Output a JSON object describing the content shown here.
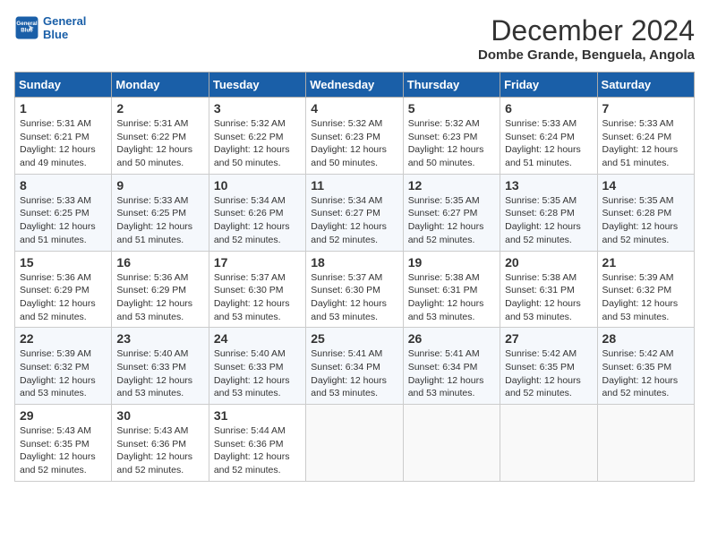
{
  "header": {
    "logo_line1": "General",
    "logo_line2": "Blue",
    "title": "December 2024",
    "subtitle": "Dombe Grande, Benguela, Angola"
  },
  "calendar": {
    "days_of_week": [
      "Sunday",
      "Monday",
      "Tuesday",
      "Wednesday",
      "Thursday",
      "Friday",
      "Saturday"
    ],
    "weeks": [
      [
        null,
        {
          "day": "2",
          "sunrise": "5:31 AM",
          "sunset": "6:22 PM",
          "daylight": "12 hours and 50 minutes."
        },
        {
          "day": "3",
          "sunrise": "5:32 AM",
          "sunset": "6:22 PM",
          "daylight": "12 hours and 50 minutes."
        },
        {
          "day": "4",
          "sunrise": "5:32 AM",
          "sunset": "6:23 PM",
          "daylight": "12 hours and 50 minutes."
        },
        {
          "day": "5",
          "sunrise": "5:32 AM",
          "sunset": "6:23 PM",
          "daylight": "12 hours and 50 minutes."
        },
        {
          "day": "6",
          "sunrise": "5:33 AM",
          "sunset": "6:24 PM",
          "daylight": "12 hours and 51 minutes."
        },
        {
          "day": "7",
          "sunrise": "5:33 AM",
          "sunset": "6:24 PM",
          "daylight": "12 hours and 51 minutes."
        }
      ],
      [
        {
          "day": "1",
          "sunrise": "5:31 AM",
          "sunset": "6:21 PM",
          "daylight": "12 hours and 49 minutes."
        },
        {
          "day": "9",
          "sunrise": "5:33 AM",
          "sunset": "6:25 PM",
          "daylight": "12 hours and 51 minutes."
        },
        {
          "day": "10",
          "sunrise": "5:34 AM",
          "sunset": "6:26 PM",
          "daylight": "12 hours and 52 minutes."
        },
        {
          "day": "11",
          "sunrise": "5:34 AM",
          "sunset": "6:27 PM",
          "daylight": "12 hours and 52 minutes."
        },
        {
          "day": "12",
          "sunrise": "5:35 AM",
          "sunset": "6:27 PM",
          "daylight": "12 hours and 52 minutes."
        },
        {
          "day": "13",
          "sunrise": "5:35 AM",
          "sunset": "6:28 PM",
          "daylight": "12 hours and 52 minutes."
        },
        {
          "day": "14",
          "sunrise": "5:35 AM",
          "sunset": "6:28 PM",
          "daylight": "12 hours and 52 minutes."
        }
      ],
      [
        {
          "day": "8",
          "sunrise": "5:33 AM",
          "sunset": "6:25 PM",
          "daylight": "12 hours and 51 minutes."
        },
        {
          "day": "16",
          "sunrise": "5:36 AM",
          "sunset": "6:29 PM",
          "daylight": "12 hours and 53 minutes."
        },
        {
          "day": "17",
          "sunrise": "5:37 AM",
          "sunset": "6:30 PM",
          "daylight": "12 hours and 53 minutes."
        },
        {
          "day": "18",
          "sunrise": "5:37 AM",
          "sunset": "6:30 PM",
          "daylight": "12 hours and 53 minutes."
        },
        {
          "day": "19",
          "sunrise": "5:38 AM",
          "sunset": "6:31 PM",
          "daylight": "12 hours and 53 minutes."
        },
        {
          "day": "20",
          "sunrise": "5:38 AM",
          "sunset": "6:31 PM",
          "daylight": "12 hours and 53 minutes."
        },
        {
          "day": "21",
          "sunrise": "5:39 AM",
          "sunset": "6:32 PM",
          "daylight": "12 hours and 53 minutes."
        }
      ],
      [
        {
          "day": "15",
          "sunrise": "5:36 AM",
          "sunset": "6:29 PM",
          "daylight": "12 hours and 52 minutes."
        },
        {
          "day": "23",
          "sunrise": "5:40 AM",
          "sunset": "6:33 PM",
          "daylight": "12 hours and 53 minutes."
        },
        {
          "day": "24",
          "sunrise": "5:40 AM",
          "sunset": "6:33 PM",
          "daylight": "12 hours and 53 minutes."
        },
        {
          "day": "25",
          "sunrise": "5:41 AM",
          "sunset": "6:34 PM",
          "daylight": "12 hours and 53 minutes."
        },
        {
          "day": "26",
          "sunrise": "5:41 AM",
          "sunset": "6:34 PM",
          "daylight": "12 hours and 53 minutes."
        },
        {
          "day": "27",
          "sunrise": "5:42 AM",
          "sunset": "6:35 PM",
          "daylight": "12 hours and 52 minutes."
        },
        {
          "day": "28",
          "sunrise": "5:42 AM",
          "sunset": "6:35 PM",
          "daylight": "12 hours and 52 minutes."
        }
      ],
      [
        {
          "day": "22",
          "sunrise": "5:39 AM",
          "sunset": "6:32 PM",
          "daylight": "12 hours and 53 minutes."
        },
        {
          "day": "30",
          "sunrise": "5:43 AM",
          "sunset": "6:36 PM",
          "daylight": "12 hours and 52 minutes."
        },
        {
          "day": "31",
          "sunrise": "5:44 AM",
          "sunset": "6:36 PM",
          "daylight": "12 hours and 52 minutes."
        },
        null,
        null,
        null,
        null
      ],
      [
        {
          "day": "29",
          "sunrise": "5:43 AM",
          "sunset": "6:35 PM",
          "daylight": "12 hours and 52 minutes."
        },
        null,
        null,
        null,
        null,
        null,
        null
      ]
    ]
  },
  "labels": {
    "sunrise": "Sunrise:",
    "sunset": "Sunset:",
    "daylight": "Daylight:"
  }
}
